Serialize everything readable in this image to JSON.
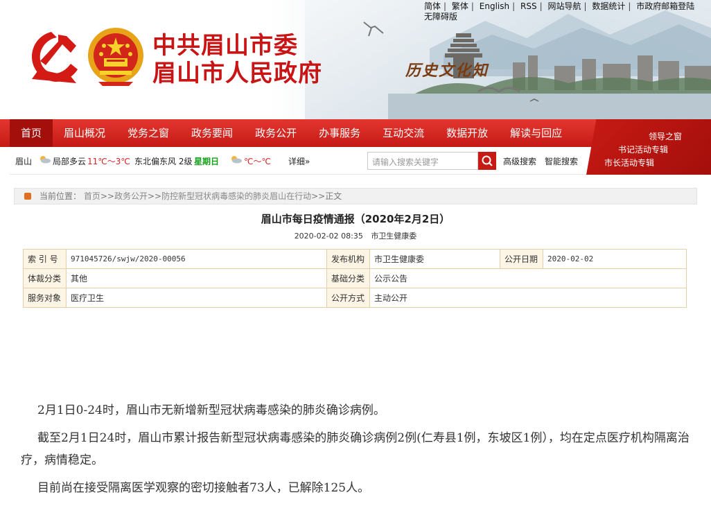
{
  "top_links": {
    "items": [
      "简体",
      "繁体",
      "English",
      "RSS",
      "网站导航",
      "数据统计",
      "市政府邮箱登陆"
    ],
    "second_line": "无障碍版"
  },
  "site_title": {
    "line1": "中共眉山市委",
    "line2": "眉山市人民政府"
  },
  "banner_text": "历史文化知",
  "nav": {
    "items": [
      "首页",
      "眉山概况",
      "党务之窗",
      "政务要闻",
      "政务公开",
      "办事服务",
      "互动交流",
      "数据开放",
      "解读与回应"
    ],
    "active_index": 0
  },
  "corner_links": [
    "领导之窗",
    "书记活动专辑",
    "市长活动专辑"
  ],
  "weather": {
    "city": "眉山",
    "condition": "局部多云",
    "temp": "11℃～3℃",
    "wind": "东北偏东风 2级",
    "weekday": "星期日",
    "temp2": "℃～℃",
    "details": "详细»"
  },
  "search": {
    "placeholder": "请输入搜索关键字",
    "advanced": "高级搜索",
    "smart": "智能搜索"
  },
  "breadcrumb": {
    "prefix": "当前位置：",
    "path": [
      "首页",
      "政务公开",
      "防控新型冠状病毒感染的肺炎眉山在行动",
      "正文"
    ]
  },
  "article": {
    "title": "眉山市每日疫情通报（2020年2月2日）",
    "datetime": "2020-02-02 08:35",
    "source": "市卫生健康委"
  },
  "info_table": {
    "row1": {
      "l1": "索 引 号",
      "v1": "971045726/swjw/2020-00056",
      "l2": "发布机构",
      "v2": "市卫生健康委",
      "l3": "公开日期",
      "v3": "2020-02-02"
    },
    "row2": {
      "l1": "体裁分类",
      "v1": "其他",
      "l2": "基础分类",
      "v2": "公示公告"
    },
    "row3": {
      "l1": "服务对象",
      "v1": "医疗卫生",
      "l2": "公开方式",
      "v2": "主动公开"
    }
  },
  "content": {
    "p1": "2月1日0-24时，眉山市无新增新型冠状病毒感染的肺炎确诊病例。",
    "p2": "截至2月1日24时，眉山市累计报告新型冠状病毒感染的肺炎确诊病例2例(仁寿县1例，东坡区1例），均在定点医疗机构隔离治疗，病情稳定。",
    "p3": "目前尚在接受隔离医学观察的密切接触者73人，已解除125人。"
  },
  "colors": {
    "brand_red": "#c81a14",
    "table_border": "#e6cfa8"
  },
  "icons": [
    "party-emblem-icon",
    "national-emblem-icon",
    "cloud-icon",
    "search-icon",
    "location-icon"
  ]
}
